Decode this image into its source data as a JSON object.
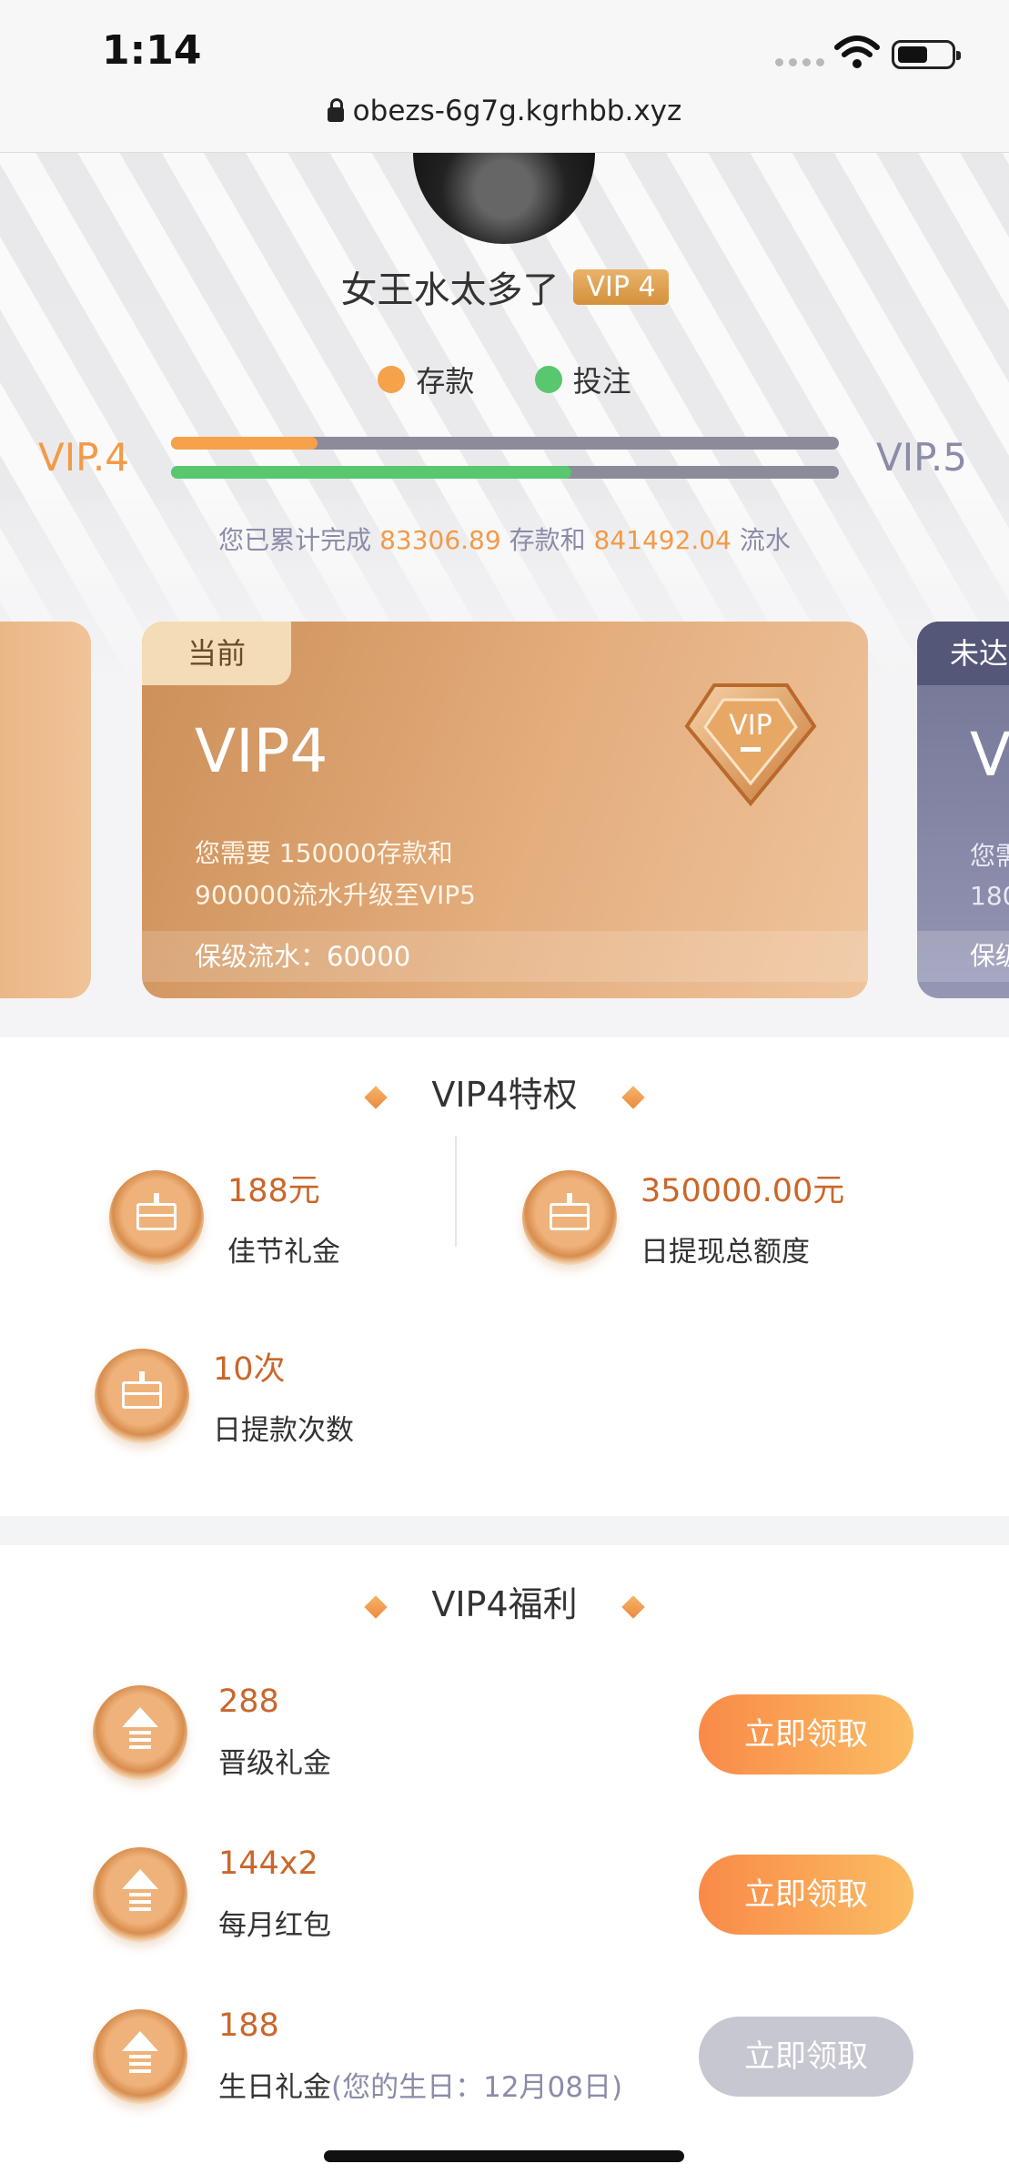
{
  "status": {
    "time": "1:14",
    "url": "obezs-6g7g.kgrhbb.xyz"
  },
  "profile": {
    "username": "女王水太多了",
    "vip_tag": "VIP 4"
  },
  "legend": [
    {
      "label": "存款",
      "color": "#f5a24a"
    },
    {
      "label": "投注",
      "color": "#58c76e"
    }
  ],
  "levels": {
    "current": "VIP.4",
    "next": "VIP.5"
  },
  "progress": {
    "deposit": {
      "fraction": 0.22,
      "color": "#f5a24a"
    },
    "bet": {
      "fraction": 0.6,
      "color": "#58c76e"
    }
  },
  "summary": {
    "prefix": "您已累计完成",
    "deposit_amount": "83306.89",
    "mid": "存款和",
    "turnover_amount": "841492.04",
    "suffix": "流水"
  },
  "current_card": {
    "tag": "当前",
    "title": "VIP4",
    "line1": "您需要  150000存款和",
    "line2": "900000流水升级至VIP5",
    "footer": "保级流水：60000",
    "badge_text": "VIP"
  },
  "next_card": {
    "tag": "未达",
    "title": "V",
    "line1": "您需",
    "line2": "180",
    "footer": "保级"
  },
  "privileges": {
    "title": "VIP4特权",
    "items": [
      {
        "value": "188元",
        "label": "佳节礼金",
        "icon": "gift-box-icon"
      },
      {
        "value": "350000.00元",
        "label": "日提现总额度",
        "icon": "gift-box-icon"
      },
      {
        "value": "10次",
        "label": "日提款次数",
        "icon": "gift-box-icon"
      }
    ]
  },
  "benefits": {
    "title": "VIP4福利",
    "items": [
      {
        "value": "288",
        "label": "晋级礼金",
        "note": "",
        "button": "立即领取",
        "enabled": true,
        "icon": "upgrade-arrow-icon"
      },
      {
        "value": "144x2",
        "label": "每月红包",
        "note": "",
        "button": "立即领取",
        "enabled": true,
        "icon": "upgrade-arrow-icon"
      },
      {
        "value": "188",
        "label": "生日礼金",
        "note": "(您的生日：12月08日)",
        "button": "立即领取",
        "enabled": false,
        "icon": "upgrade-arrow-icon"
      }
    ]
  }
}
